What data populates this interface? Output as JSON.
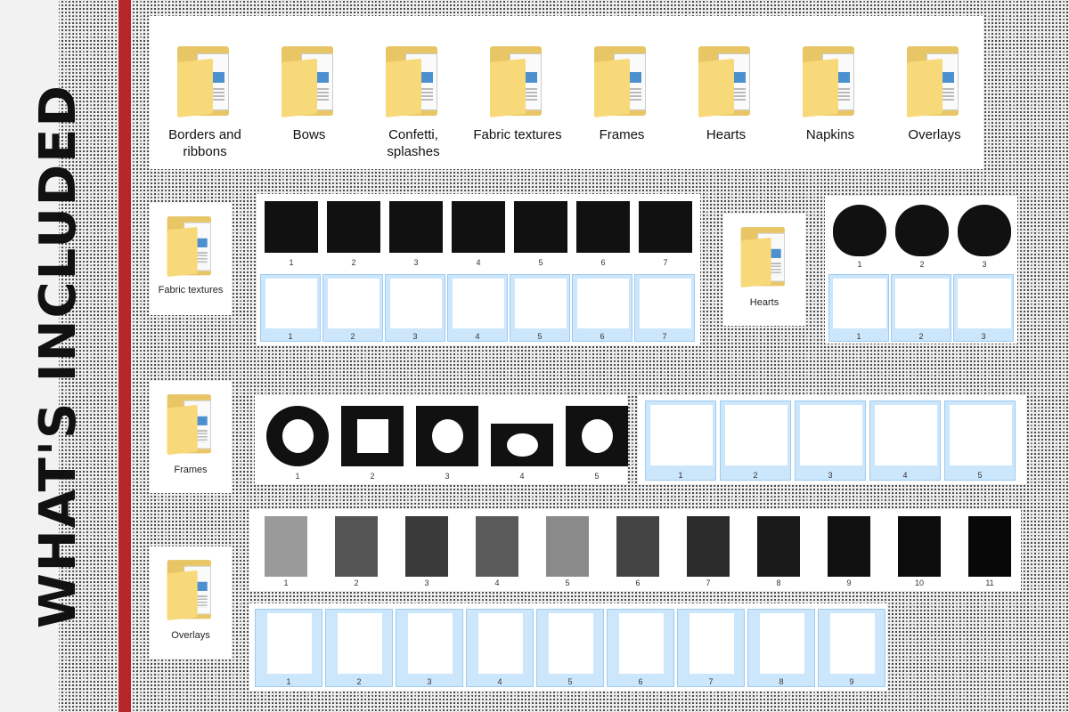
{
  "side_title": "WHAT'S INCLUDED",
  "top_folders": [
    "Borders and ribbons",
    "Bows",
    "Confetti, splashes",
    "Fabric textures",
    "Frames",
    "Hearts",
    "Napkins",
    "Overlays"
  ],
  "fabric": {
    "folder_label": "Fabric textures",
    "numbers": [
      "1",
      "2",
      "3",
      "4",
      "5",
      "6",
      "7"
    ]
  },
  "hearts": {
    "folder_label": "Hearts",
    "numbers": [
      "1",
      "2",
      "3"
    ]
  },
  "frames": {
    "folder_label": "Frames",
    "numbers": [
      "1",
      "2",
      "3",
      "4",
      "5"
    ]
  },
  "overlays": {
    "folder_label": "Overlays",
    "numbers_dark": [
      "1",
      "2",
      "3",
      "4",
      "5",
      "6",
      "7",
      "8",
      "9",
      "10",
      "11"
    ],
    "numbers_light": [
      "1",
      "2",
      "3",
      "4",
      "5",
      "6",
      "7",
      "8",
      "9"
    ]
  },
  "colors": {
    "accent_red": "#b5262b",
    "selection_blue": "#cce6fb",
    "folder_yellow": "#f8d97a"
  }
}
